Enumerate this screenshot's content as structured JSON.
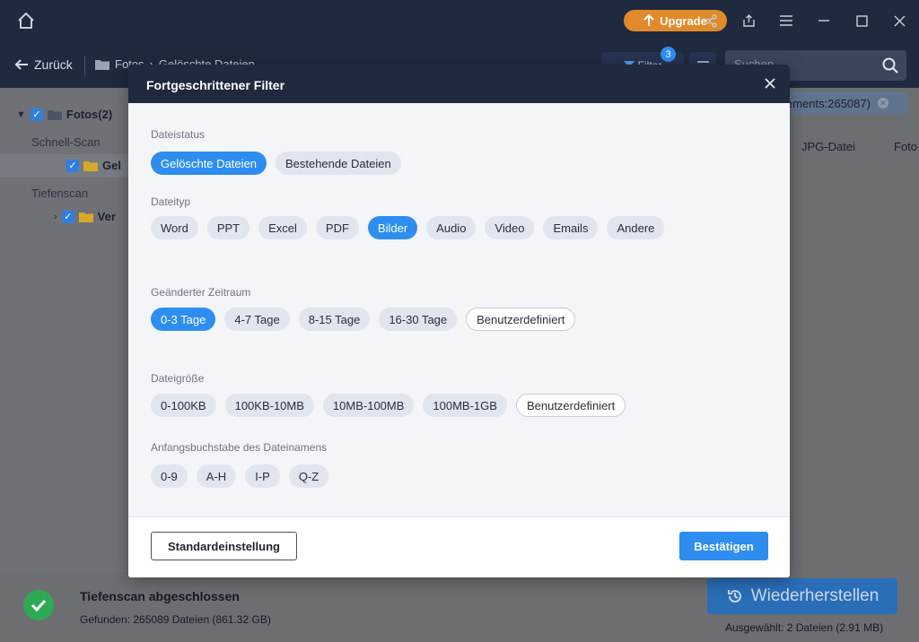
{
  "app": {
    "upgrade_label": "Upgrade",
    "back_label": "Zurück",
    "breadcrumb": [
      "Fotos",
      "Gelöschte Dateien"
    ],
    "filter_label": "Filter",
    "filter_count": "3",
    "search_placeholder": "Suchen"
  },
  "sidebar": {
    "root_label": "Fotos(2)",
    "quick_scan_label": "Schnell-Scan",
    "quick_item_label": "Gel",
    "deep_scan_label": "Tiefenscan",
    "deep_item_label": "Ver"
  },
  "content": {
    "count_chip": "ements:265087)",
    "columns": [
      "JPG-Datei",
      "Foto"
    ]
  },
  "status": {
    "title": "Tiefenscan abgeschlossen",
    "found": "Gefunden: 265089 Dateien (861.32 GB)",
    "restore_label": "Wiederherstellen",
    "selected": "Ausgewählt: 2 Dateien (2.91 MB)"
  },
  "modal": {
    "title": "Fortgeschrittener Filter",
    "sections": {
      "status": {
        "label": "Dateistatus",
        "options": [
          "Gelöschte Dateien",
          "Bestehende Dateien"
        ],
        "active": "Gelöschte Dateien"
      },
      "type": {
        "label": "Dateityp",
        "options": [
          "Word",
          "PPT",
          "Excel",
          "PDF",
          "Bilder",
          "Audio",
          "Video",
          "Emails",
          "Andere"
        ],
        "active": "Bilder"
      },
      "time": {
        "label": "Geänderter Zeitraum",
        "options": [
          "0-3 Tage",
          "4-7 Tage",
          "8-15 Tage",
          "16-30 Tage",
          "Benutzerdefiniert"
        ],
        "active": "0-3 Tage"
      },
      "size": {
        "label": "Dateigröße",
        "options": [
          "0-100KB",
          "100KB-10MB",
          "10MB-100MB",
          "100MB-1GB",
          "Benutzerdefiniert"
        ],
        "active": ""
      },
      "letter": {
        "label": "Anfangsbuchstabe des Dateinamens",
        "options": [
          "0-9",
          "A-H",
          "I-P",
          "Q-Z"
        ],
        "active": ""
      }
    },
    "default_label": "Standardeinstellung",
    "confirm_label": "Bestätigen"
  },
  "colors": {
    "accent": "#2e8ef0",
    "header": "#1f2a3f",
    "upgrade": "#e08a2a",
    "success": "#2eaa55"
  }
}
